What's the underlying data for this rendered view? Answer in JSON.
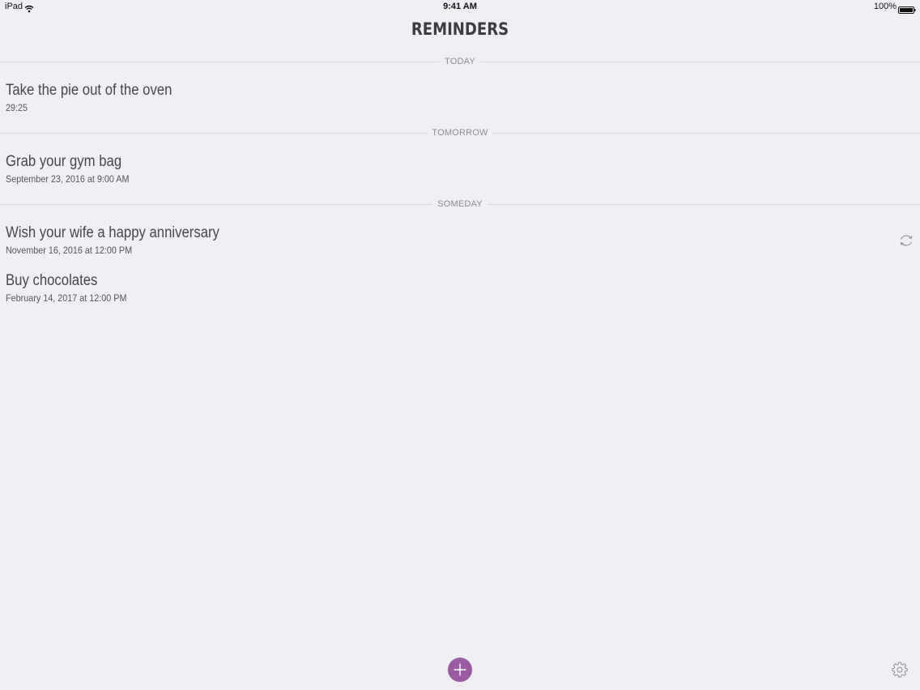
{
  "status_bar": {
    "device": "iPad",
    "time": "9:41 AM",
    "battery": "100%"
  },
  "header": {
    "title": "REMINDERS"
  },
  "sections": [
    {
      "label": "TODAY",
      "items": [
        {
          "title": "Take the pie out of the oven",
          "time": "29:25",
          "repeat": false
        }
      ]
    },
    {
      "label": "TOMORROW",
      "items": [
        {
          "title": "Grab your gym bag",
          "time": "September 23, 2016 at 9:00 AM",
          "repeat": false
        }
      ]
    },
    {
      "label": "SOMEDAY",
      "items": [
        {
          "title": "Wish your wife a happy anniversary",
          "time": "November 16, 2016 at 12:00 PM",
          "repeat": true
        },
        {
          "title": "Buy chocolates",
          "time": "February 14, 2017 at 12:00 PM",
          "repeat": false
        }
      ]
    }
  ],
  "icons": {
    "wifi": "wifi-icon",
    "battery": "battery-icon",
    "repeat": "repeat-icon",
    "add": "plus-icon",
    "settings": "gear-icon"
  },
  "colors": {
    "background": "#efeff4",
    "accent": "#9a5ba3",
    "divider": "#d6d6da",
    "section_label": "#8a8a90",
    "text": "#46464b"
  }
}
